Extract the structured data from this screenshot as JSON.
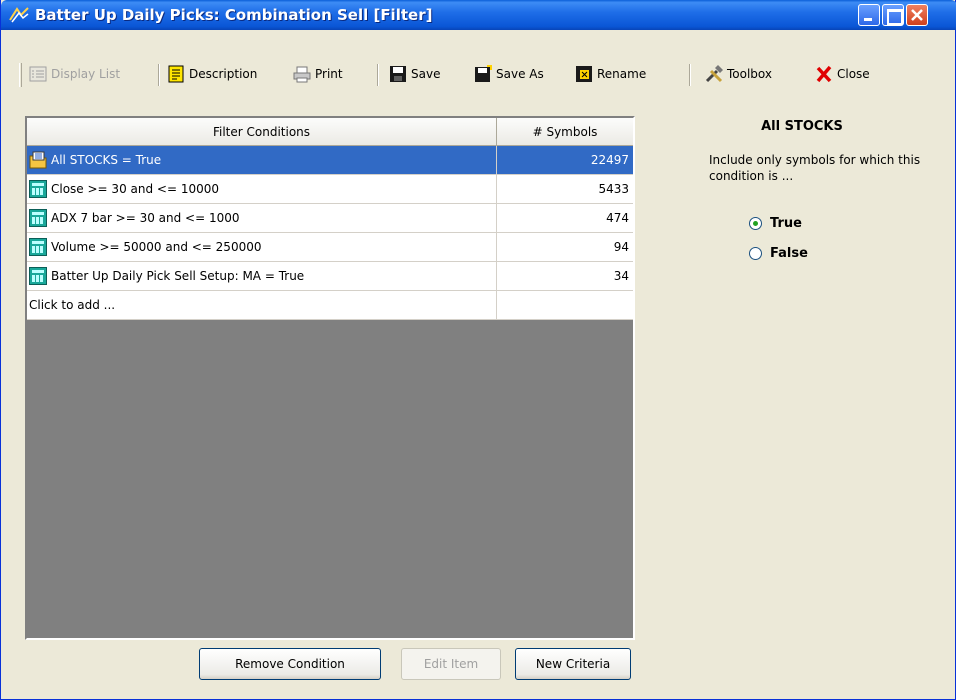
{
  "window": {
    "title": "Batter Up Daily Picks: Combination Sell   [Filter]"
  },
  "toolbar": {
    "display_list": "Display List",
    "description": "Description",
    "print": "Print",
    "save": "Save",
    "save_as": "Save As",
    "rename": "Rename",
    "toolbox": "Toolbox",
    "close": "Close"
  },
  "grid": {
    "headers": [
      "Filter Conditions",
      "# Symbols"
    ],
    "rows": [
      {
        "condition": "All STOCKS  = True",
        "symbols": "22497",
        "icon": "folder-list-icon",
        "selected": true
      },
      {
        "condition": "Close  >= 30 and  <= 10000",
        "symbols": "5433",
        "icon": "calculator-icon"
      },
      {
        "condition": "ADX 7 bar  >= 30 and  <= 1000",
        "symbols": "474",
        "icon": "calculator-icon"
      },
      {
        "condition": "Volume  >= 50000 and  <= 250000",
        "symbols": "94",
        "icon": "calculator-icon"
      },
      {
        "condition": "Batter Up Daily Pick Sell Setup: MA  = True",
        "symbols": "34",
        "icon": "calculator-icon"
      },
      {
        "condition": "Click to add ...",
        "symbols": ""
      }
    ]
  },
  "buttons": {
    "remove": "Remove Condition",
    "edit": "Edit Item",
    "new": "New Criteria"
  },
  "panel": {
    "title": "All STOCKS",
    "text": "Include only symbols for which this condition is ...",
    "true_label": "True",
    "false_label": "False",
    "selected": "True"
  },
  "colors": {
    "title_bar": "#0a56d6",
    "selection": "#316ac5",
    "grid_background": "#808080",
    "window_background": "#ece9d8"
  }
}
